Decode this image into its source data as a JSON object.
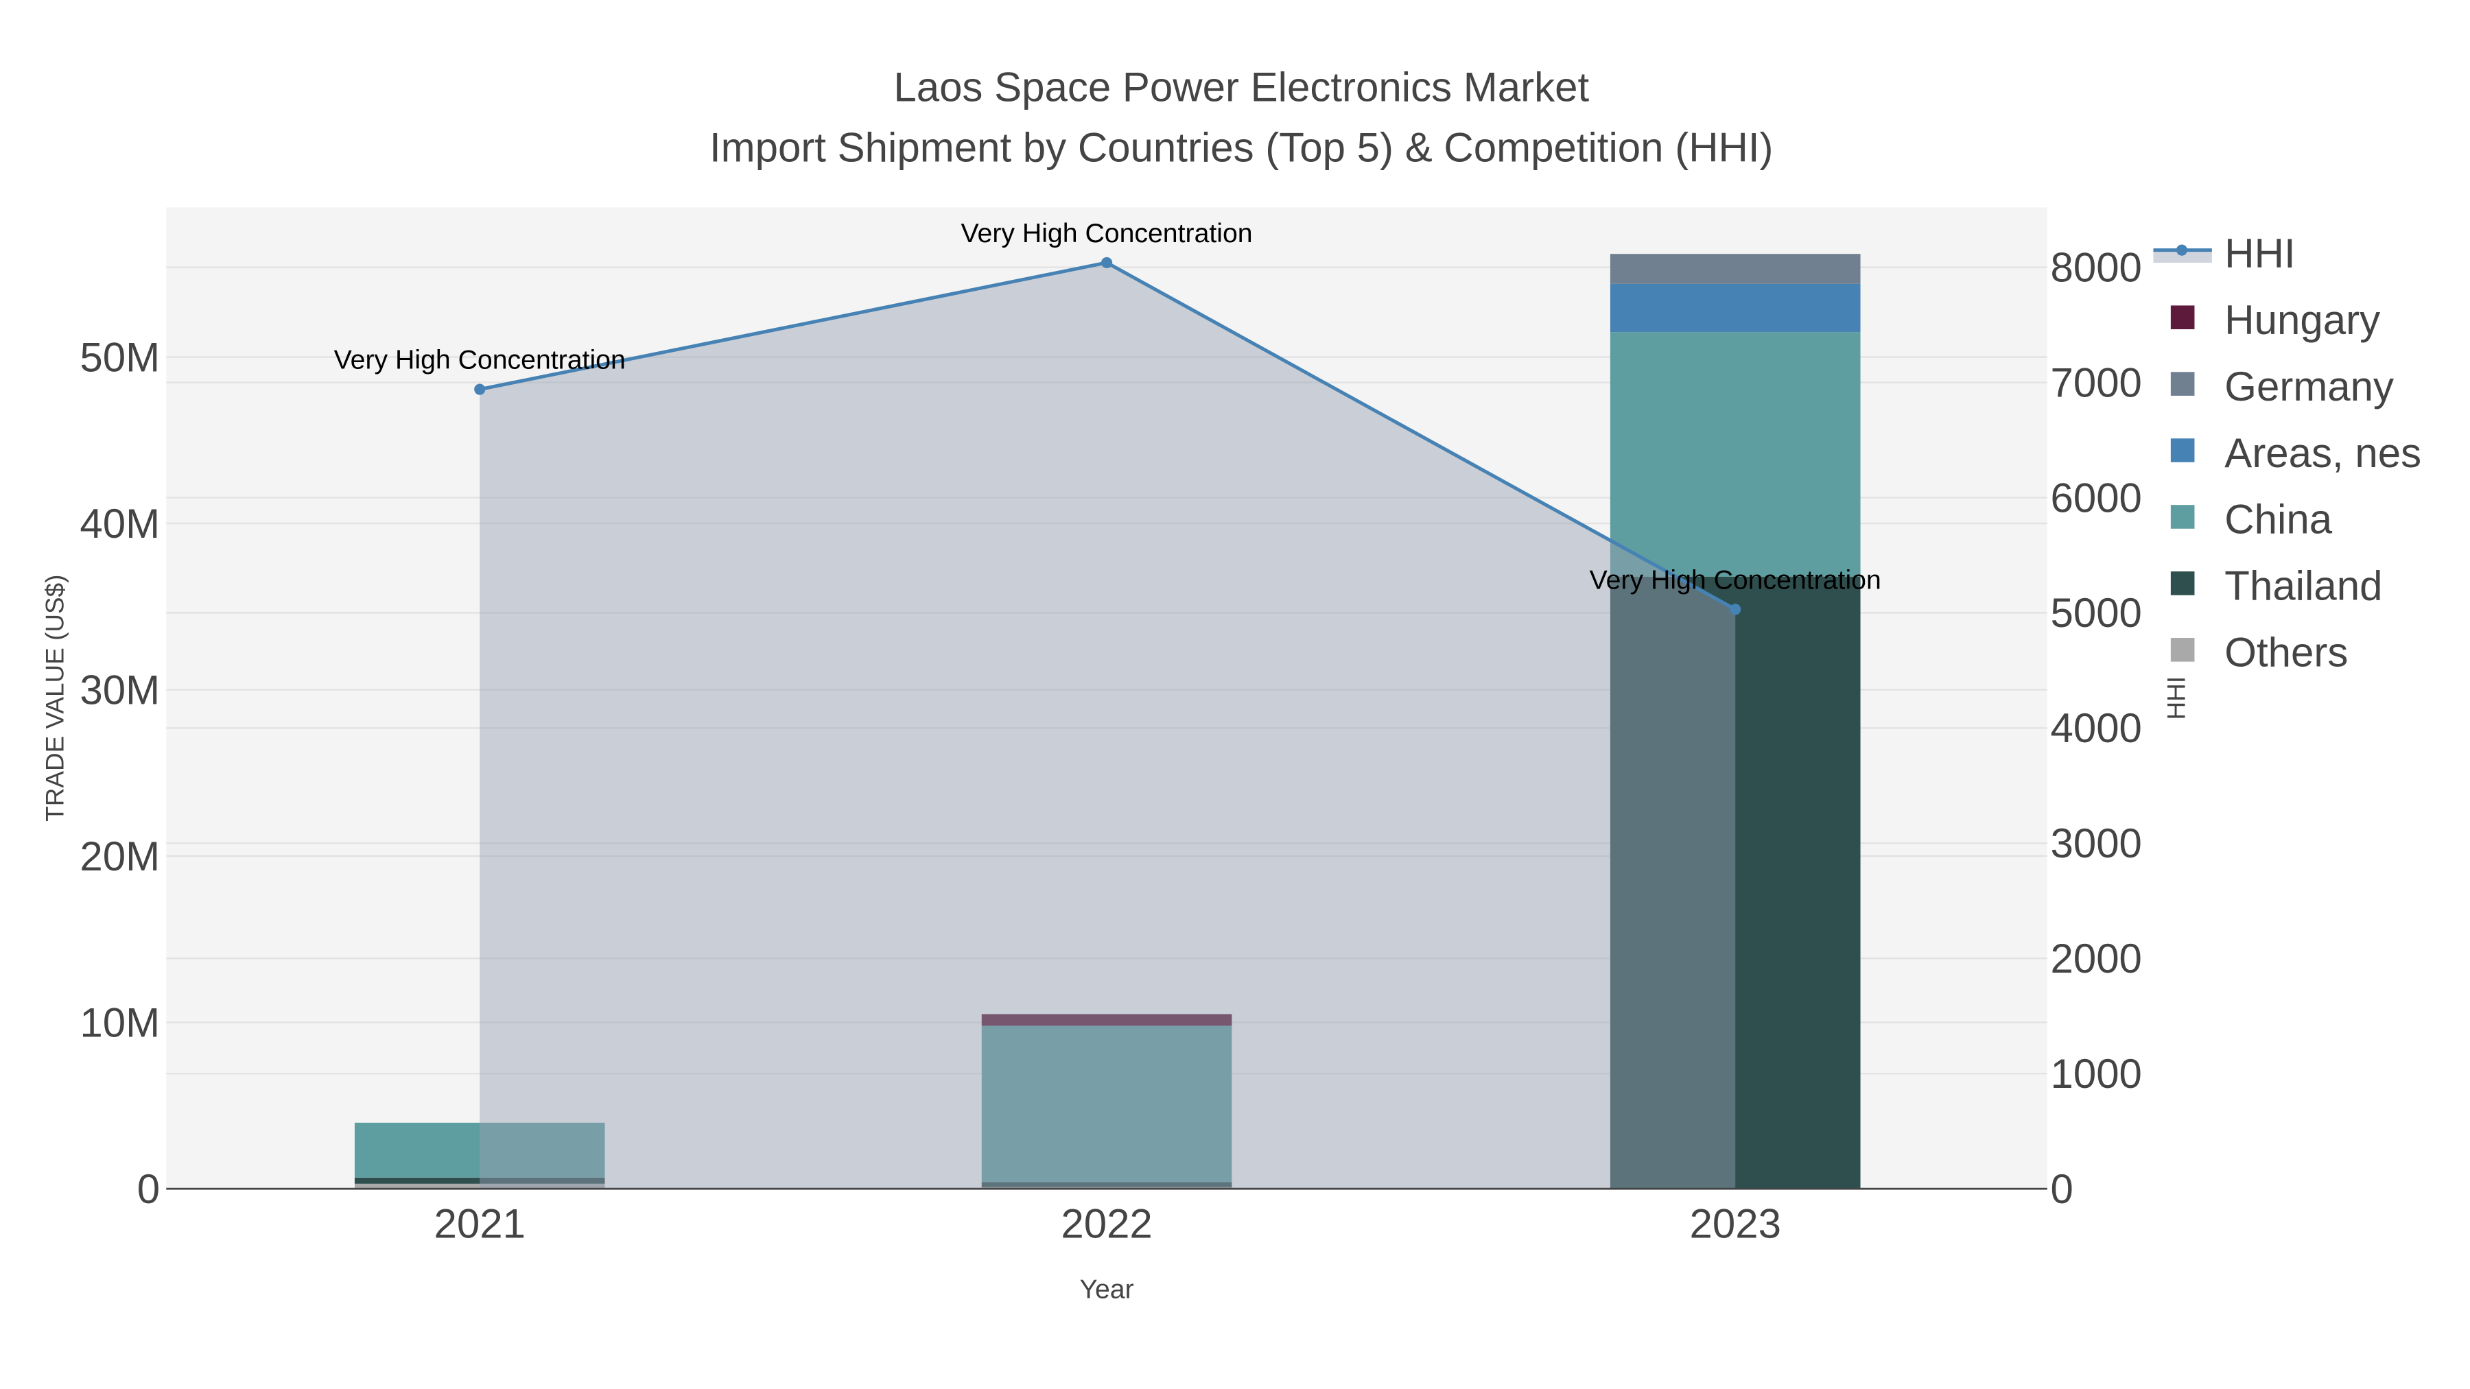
{
  "chart_data": {
    "type": "bar",
    "title_line1": "Laos Space Power Electronics Market",
    "title_line2": "Import Shipment by Countries (Top 5) & Competition (HHI)",
    "xlabel": "Year",
    "ylabel": "TRADE VALUE (US$)",
    "y2label": "HHI",
    "categories": [
      "2021",
      "2022",
      "2023"
    ],
    "ylim": [
      0,
      59000000
    ],
    "y2lim": [
      0,
      8520
    ],
    "yticks": [
      0,
      10000000,
      20000000,
      30000000,
      40000000,
      50000000
    ],
    "ytick_labels": [
      "0",
      "10M",
      "20M",
      "30M",
      "40M",
      "50M"
    ],
    "y2ticks": [
      0,
      1000,
      2000,
      3000,
      4000,
      5000,
      6000,
      7000,
      8000
    ],
    "y2tick_labels": [
      "0",
      "1000",
      "2000",
      "3000",
      "4000",
      "5000",
      "6000",
      "7000",
      "8000"
    ],
    "series": [
      {
        "name": "Others",
        "color": "#a9a9a9",
        "values": [
          300000,
          100000,
          0
        ]
      },
      {
        "name": "Thailand",
        "color": "#2f4f4f",
        "values": [
          370000,
          300000,
          36800000
        ]
      },
      {
        "name": "China",
        "color": "#5f9ea0",
        "values": [
          3300000,
          9400000,
          14700000
        ]
      },
      {
        "name": "Areas, nes",
        "color": "#4682b4",
        "values": [
          0,
          0,
          2900000
        ]
      },
      {
        "name": "Germany",
        "color": "#708090",
        "values": [
          0,
          0,
          1800000
        ]
      },
      {
        "name": "Hungary",
        "color": "#5e1a3a",
        "values": [
          0,
          700000,
          0
        ]
      }
    ],
    "hhi": {
      "name": "HHI",
      "color": "#4682b4",
      "values": [
        6940,
        8040,
        5030
      ],
      "annotations": [
        "Very High Concentration",
        "Very High Concentration",
        "Very High Concentration"
      ]
    },
    "legend_order": [
      "HHI",
      "Hungary",
      "Germany",
      "Areas, nes",
      "China",
      "Thailand",
      "Others"
    ],
    "legend_position": "right",
    "grid": true
  }
}
